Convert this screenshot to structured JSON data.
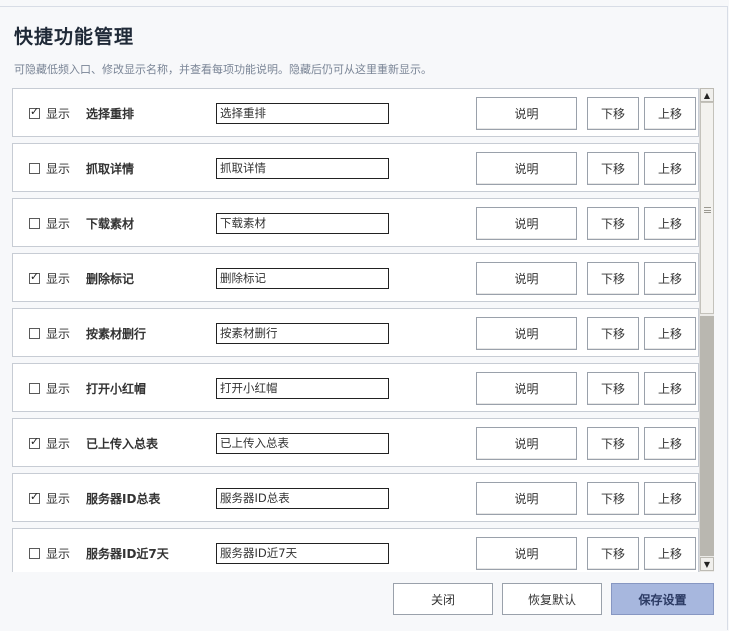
{
  "window": {
    "title": "快捷功能管理",
    "subtitle": "可隐藏低频入口、修改显示名称，并查看每项功能说明。隐藏后仍可从这里重新显示。"
  },
  "row_labels": {
    "show": "显示",
    "desc_button": "说明",
    "down_button": "下移",
    "up_button": "上移"
  },
  "items": [
    {
      "name": "选择重排",
      "display_name": "选择重排",
      "checked": true
    },
    {
      "name": "抓取详情",
      "display_name": "抓取详情",
      "checked": false
    },
    {
      "name": "下载素材",
      "display_name": "下载素材",
      "checked": false
    },
    {
      "name": "删除标记",
      "display_name": "删除标记",
      "checked": true
    },
    {
      "name": "按素材删行",
      "display_name": "按素材删行",
      "checked": false
    },
    {
      "name": "打开小红帽",
      "display_name": "打开小红帽",
      "checked": false
    },
    {
      "name": "已上传入总表",
      "display_name": "已上传入总表",
      "checked": true
    },
    {
      "name": "服务器ID总表",
      "display_name": "服务器ID总表",
      "checked": true
    },
    {
      "name": "服务器ID近7天",
      "display_name": "服务器ID近7天",
      "checked": false
    }
  ],
  "footer": {
    "close_label": "关闭",
    "reset_label": "恢复默认",
    "save_label": "保存设置"
  },
  "colors": {
    "save_button_bg": "#a7b7de",
    "row_border": "#c7ccd4"
  }
}
